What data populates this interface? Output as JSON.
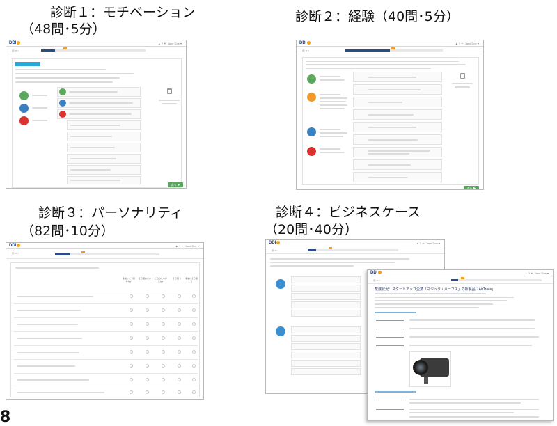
{
  "headings": {
    "d1_line1": "診断１：モチベーション",
    "d1_line2": "（48問･5分）",
    "d2": "診断２：経験（40問･5分）",
    "d3_line1": "診断３：パーソナリティ",
    "d3_line2": "（82問･10分）",
    "d4_line1": "診断４：ビジネスケース",
    "d4_line2": "（20問･40分）"
  },
  "screens": {
    "logo": "DDI",
    "d1_next": "次へ ▶",
    "d2_next": "次へ ▶",
    "d3_cols": [
      "非常にそう思わない",
      "そう思わない",
      "どちらともいえない",
      "そう思う",
      "非常にそう思う"
    ],
    "d4_section_title": "業務状況：スタートアップ企業「マジック・ハーブス」の新製品「AirTrace」"
  },
  "slide_number": "8",
  "colors": {
    "teal": "#2aa8d8",
    "green": "#5aa85c",
    "blue": "#3a7fc2",
    "red": "#d9322f",
    "navy": "#2b4c8a",
    "orange": "#f09a2a"
  }
}
